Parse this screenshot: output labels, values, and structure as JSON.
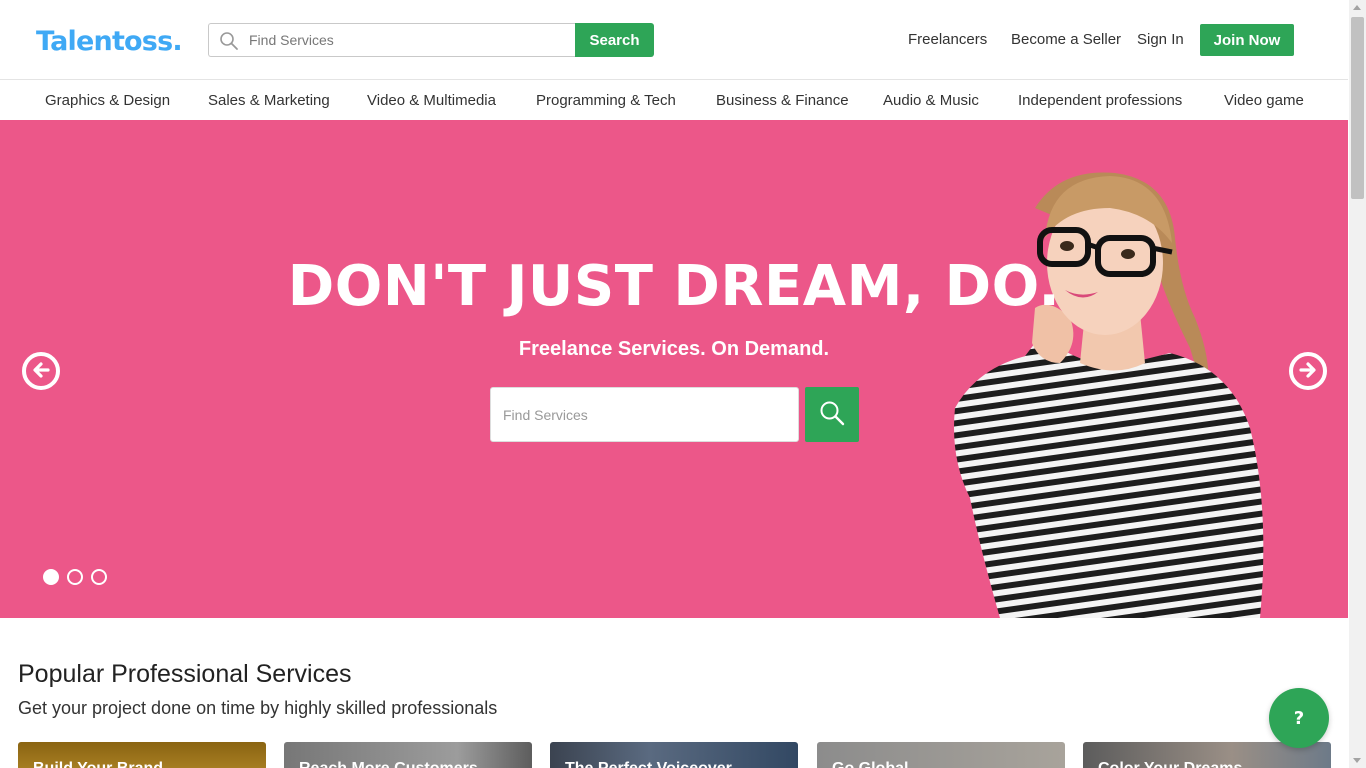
{
  "header": {
    "logo": "Talentoss.",
    "search": {
      "placeholder": "Find Services",
      "button_label": "Search"
    },
    "nav": {
      "freelancers": "Freelancers",
      "become_seller": "Become a Seller",
      "sign_in": "Sign In",
      "join_now": "Join Now"
    }
  },
  "categories": [
    "Graphics & Design",
    "Sales & Marketing",
    "Video & Multimedia",
    "Programming & Tech",
    "Business & Finance",
    "Audio & Music",
    "Independent professions",
    "Video game"
  ],
  "hero": {
    "headline": "DON'T JUST DREAM, DO.",
    "subline": "Freelance Services. On Demand.",
    "search_placeholder": "Find Services",
    "slides": {
      "count": 3,
      "active": 1
    }
  },
  "popular": {
    "title": "Popular Professional Services",
    "subtitle": "Get your project done on time by highly skilled professionals",
    "cards": [
      "Build Your Brand",
      "Reach More Customers",
      "The Perfect Voiceover",
      "Go Global",
      "Color Your Dreams"
    ]
  },
  "help_button": "?",
  "colors": {
    "brand_blue": "#3fa9f5",
    "accent_green": "#2ea557",
    "hero_pink": "#ec5789"
  }
}
